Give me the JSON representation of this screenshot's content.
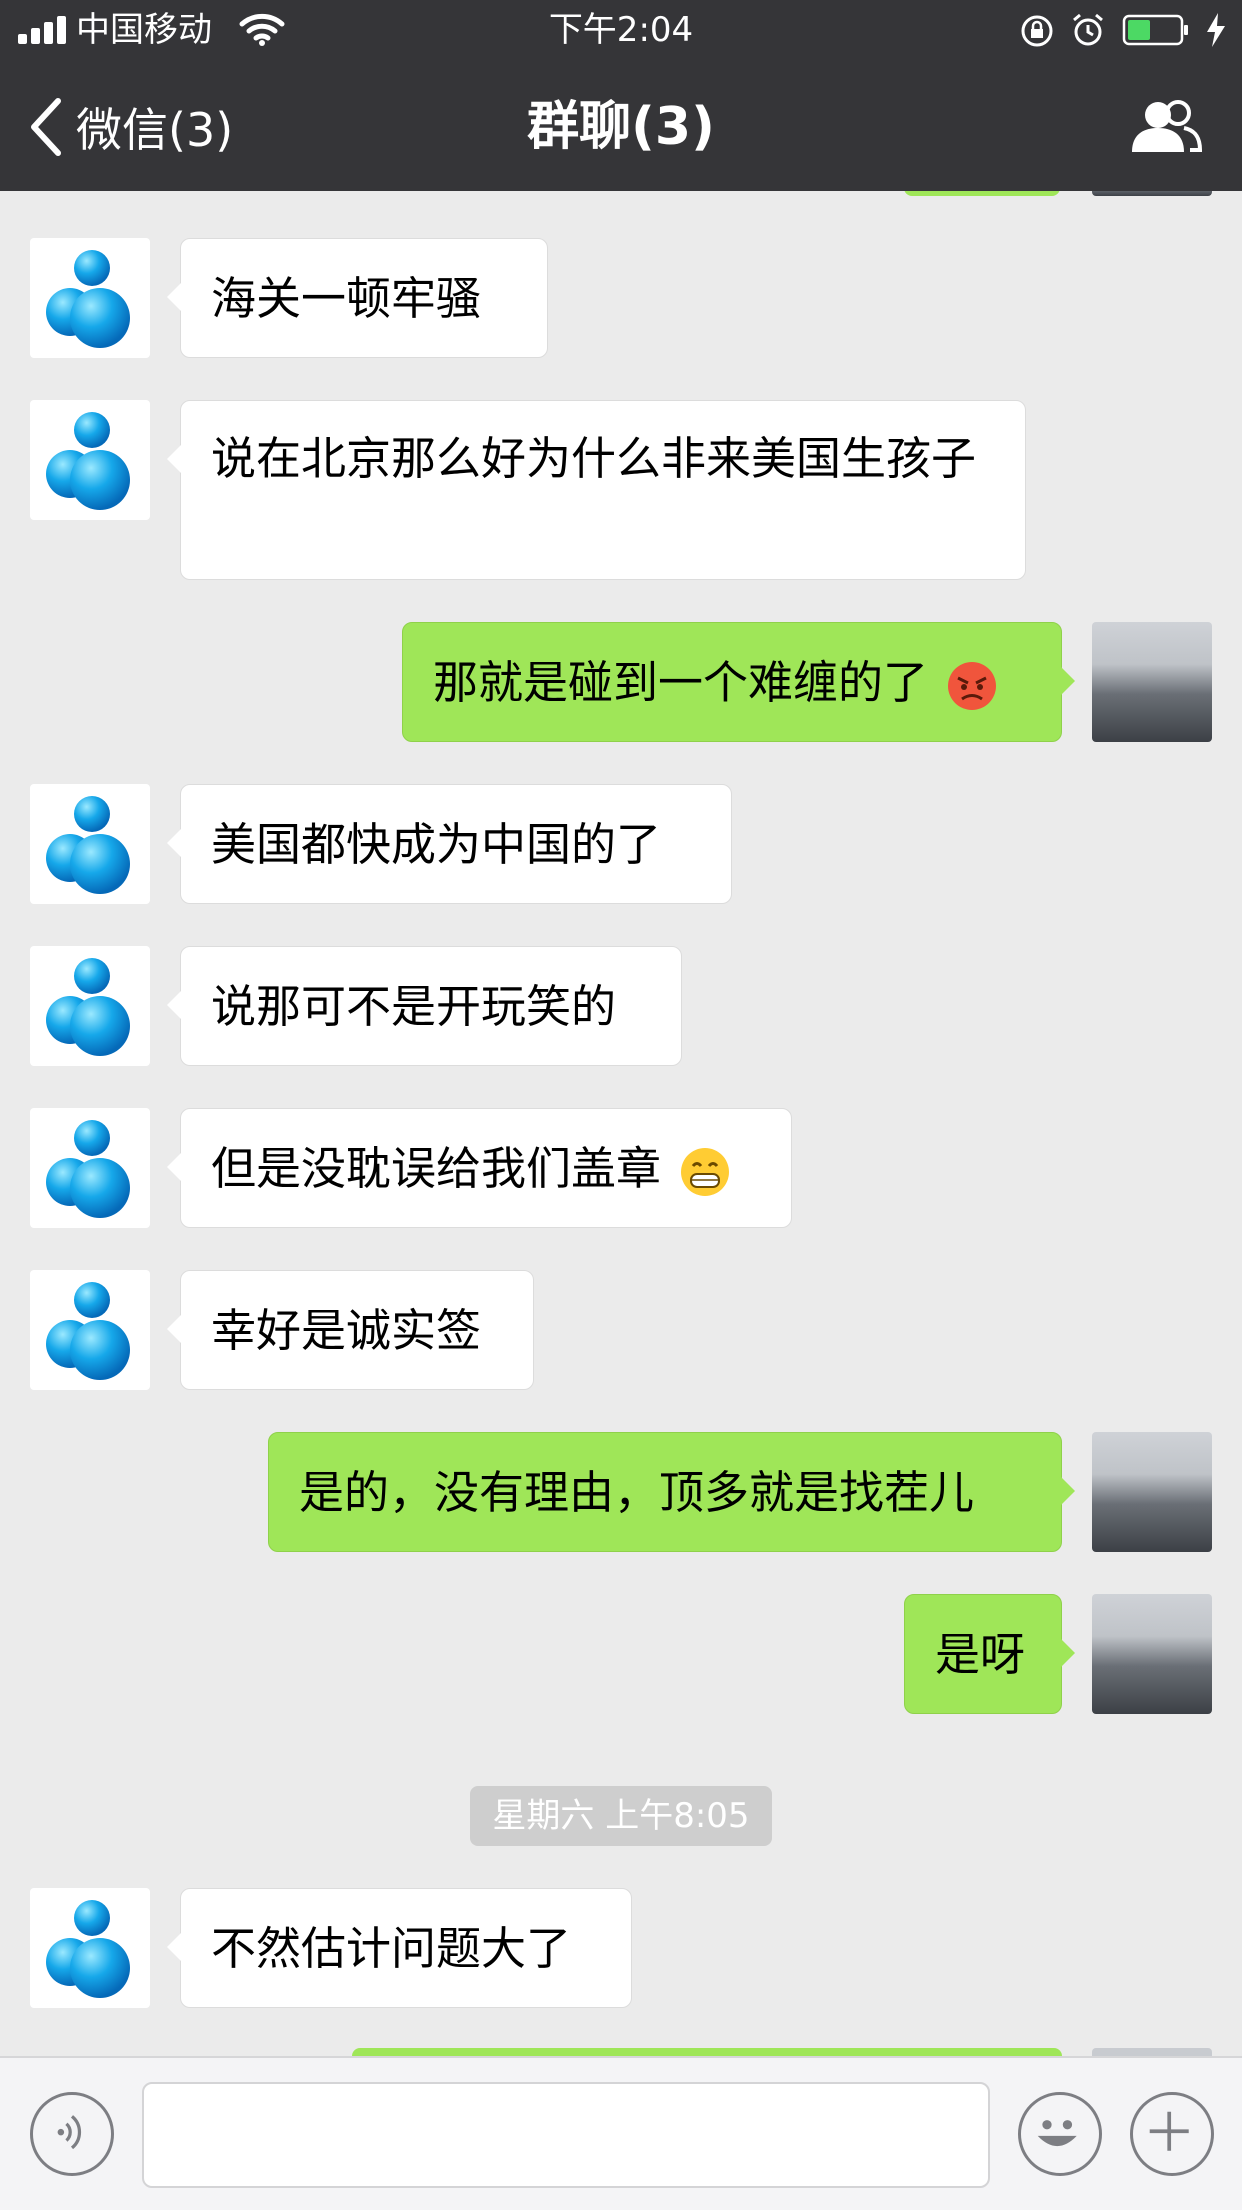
{
  "status_bar": {
    "carrier": "中国移动",
    "time": "下午2:04"
  },
  "nav": {
    "back_label": "微信(3)",
    "title": "群聊(3)",
    "members_icon": "group-members-icon"
  },
  "messages": [
    {
      "side": "left",
      "text": "海关一顿牢骚"
    },
    {
      "side": "left",
      "text": "说在北京那么好为什么非来美国生孩子"
    },
    {
      "side": "right",
      "text": "那就是碰到一个难缠的了",
      "emoji": "angry-face-emoji"
    },
    {
      "side": "left",
      "text": "美国都快成为中国的了"
    },
    {
      "side": "left",
      "text": "说那可不是开玩笑的"
    },
    {
      "side": "left",
      "text": "但是没耽误给我们盖章",
      "emoji": "grinning-face-emoji"
    },
    {
      "side": "left",
      "text": "幸好是诚实签"
    },
    {
      "side": "right",
      "text": "是的，没有理由，顶多就是找茬儿"
    },
    {
      "side": "right",
      "text": "是呀"
    },
    {
      "side": "left",
      "text": "不然估计问题大了"
    }
  ],
  "timestamp": "星期六 上午8:05",
  "input_bar": {
    "voice_icon": "voice-icon",
    "emoji_icon": "emoji-icon",
    "plus_icon": "plus-icon"
  },
  "colors": {
    "header_bg": "#353538",
    "chat_bg": "#ebebeb",
    "outgoing_bubble": "#9fe658",
    "incoming_bubble": "#ffffff"
  }
}
